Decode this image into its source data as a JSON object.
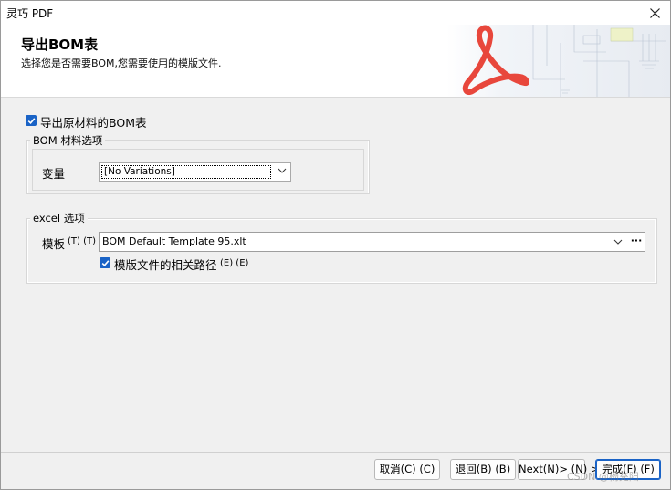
{
  "window": {
    "title": "灵巧 PDF"
  },
  "header": {
    "title": "导出BOM表",
    "subtitle": "选择您是否需要BOM,您需要使用的模版文件."
  },
  "export_raw_bom": {
    "label": "导出原材料的BOM表",
    "checked": true
  },
  "bom_options": {
    "group_title": "BOM 材料选项",
    "variant_label": "变量",
    "variant_value": "[No Variations]"
  },
  "excel_options": {
    "group_title": "excel 选项",
    "template_label": "模板",
    "template_shortcut": "(T) (T)",
    "template_value": "BOM Default Template 95.xlt",
    "browse_label": "···",
    "relative_path_label": "模版文件的相关路径",
    "relative_path_shortcut": "(E) (E)",
    "relative_path_checked": true
  },
  "footer": {
    "cancel": "取消(C) (C)",
    "back": "退回(B) (B)",
    "next": "Next(N)> (N) >",
    "finish": "完成(F) (F)"
  },
  "watermark": "CSDN @杨充阳",
  "colors": {
    "accent": "#1a63c6",
    "banner_logo": "#e8473c"
  }
}
